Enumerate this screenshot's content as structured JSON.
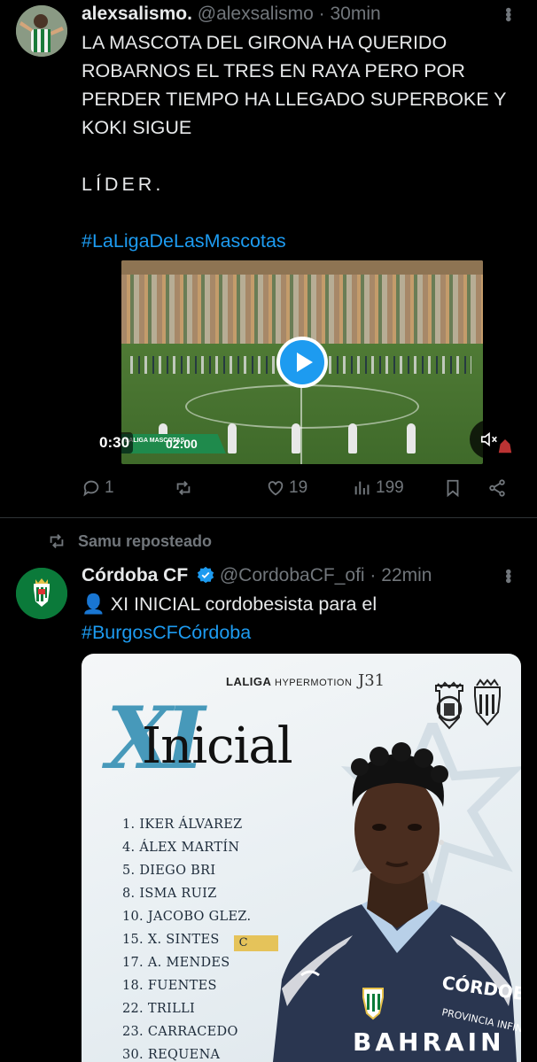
{
  "tweet1": {
    "display_name": "alexsalismo.",
    "handle": "@alexsalismo",
    "separator": "·",
    "time": "30min",
    "text": "LA MASCOTA DEL GIRONA HA QUERIDO ROBARNOS EL TRES EN RAYA PERO POR PERDER TIEMPO HA LLEGADO SUPERBOKE Y KOKI SIGUE",
    "text2": "LÍDER.",
    "hashtag": "#LaLigaDeLasMascotas",
    "video": {
      "duration": "0:30",
      "scorebug_label": "LALIGA MASCOTAS",
      "scorebug_time": "02:00"
    },
    "actions": {
      "replies": "1",
      "reposts": "",
      "likes": "19",
      "views": "199"
    }
  },
  "repost_context": "Samu reposteado",
  "tweet2": {
    "display_name": "Córdoba CF",
    "handle": "@CordobaCF_ofi",
    "separator": "·",
    "time": "22min",
    "text_prefix": "👤",
    "text": "XI INICIAL cordobesista para el",
    "hashtag": "#BurgosCFCórdoba",
    "graphic": {
      "laliga": "LALIGA",
      "hypermotion": "HYPERMOTION",
      "jornada": "J31",
      "xi": "XI",
      "title": "Inicial",
      "players": [
        "1. IKER ÁLVAREZ",
        "4. ÁLEX MARTÍN",
        "5. DIEGO BRI",
        "8. ISMA RUIZ",
        "10. JACOBO GLEZ.",
        "15. X. SINTES",
        "17. A. MENDES",
        "18. FUENTES",
        "22. TRILLI",
        "23. CARRACEDO",
        "30. REQUENA"
      ],
      "captain_mark": "C",
      "shirt_text1": "CÓRDOBA",
      "shirt_text2": "PROVINCIA INFINITA",
      "shirt_text3": "BAHRAIN"
    }
  },
  "colors": {
    "background": "#000000",
    "text": "#e7e9ea",
    "secondary": "#71767b",
    "accent": "#1d9bf0",
    "divider": "#2f3336",
    "cordoba_green": "#0b7a3a"
  }
}
